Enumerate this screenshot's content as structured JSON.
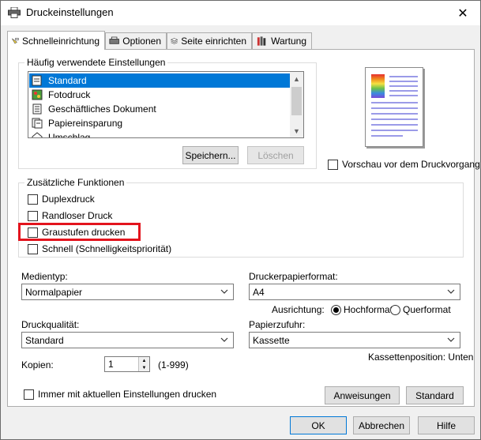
{
  "window": {
    "title": "Druckeinstellungen"
  },
  "tabs": [
    {
      "label": "Schnelleinrichtung",
      "icon": "printer-setup-icon"
    },
    {
      "label": "Optionen",
      "icon": "options-icon"
    },
    {
      "label": "Seite einrichten",
      "icon": "page-setup-icon"
    },
    {
      "label": "Wartung",
      "icon": "maintenance-icon"
    }
  ],
  "common": {
    "label": "Häufig verwendete Einstellungen",
    "items": [
      {
        "label": "Standard",
        "selected": true
      },
      {
        "label": "Fotodruck"
      },
      {
        "label": "Geschäftliches Dokument"
      },
      {
        "label": "Papiereinsparung"
      },
      {
        "label": "Umschlag"
      }
    ],
    "save_button": "Speichern...",
    "delete_button": "Löschen"
  },
  "preview": {
    "checkbox_label": "Vorschau vor dem Druckvorgang"
  },
  "additional": {
    "label": "Zusätzliche Funktionen",
    "options": [
      {
        "label": "Duplexdruck",
        "checked": false
      },
      {
        "label": "Randloser Druck",
        "checked": false
      },
      {
        "label": "Graustufen drucken",
        "checked": false
      },
      {
        "label": "Schnell (Schnelligkeitspriorität)",
        "checked": false
      }
    ]
  },
  "media": {
    "label": "Medientyp:",
    "value": "Normalpapier"
  },
  "paper_format": {
    "label": "Druckerpapierformat:",
    "value": "A4"
  },
  "orientation": {
    "label": "Ausrichtung:",
    "portrait": "Hochformat",
    "landscape": "Querformat",
    "selected": "Hochformat"
  },
  "quality": {
    "label": "Druckqualität:",
    "value": "Standard"
  },
  "feed": {
    "label": "Papierzufuhr:",
    "value": "Kassette"
  },
  "cassette_position": "Kassettenposition: Unten",
  "copies": {
    "label": "Kopien:",
    "value": "1",
    "range": "(1-999)"
  },
  "always_print": {
    "label": "Immer mit aktuellen Einstellungen drucken",
    "checked": false
  },
  "buttons": {
    "instructions": "Anweisungen",
    "defaults": "Standard",
    "ok": "OK",
    "cancel": "Abbrechen",
    "help": "Hilfe"
  },
  "colors": {
    "selection": "#0078d7",
    "highlight_border": "#e3141d"
  }
}
